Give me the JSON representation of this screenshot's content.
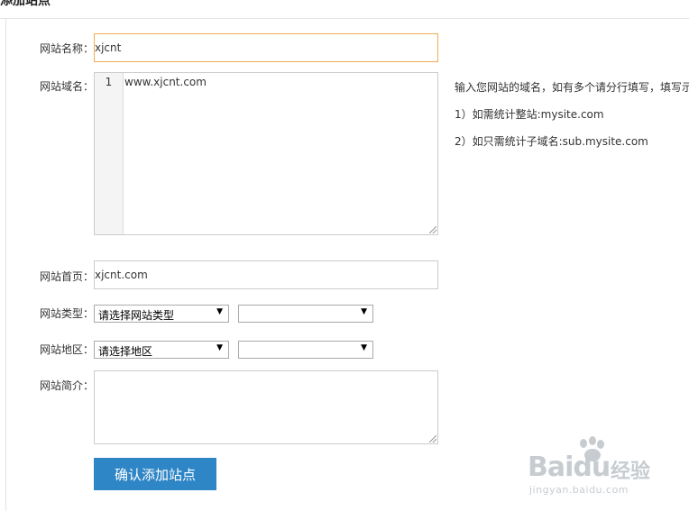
{
  "page": {
    "heading": "添加站点"
  },
  "form": {
    "site_name": {
      "label": "网站名称：",
      "value": "xjcnt"
    },
    "site_domain": {
      "label": "网站域名：",
      "line_number": "1",
      "value": "www.xjcnt.com",
      "help": [
        "输入您网站的域名，如有多个请分行填写，填写示",
        "1）如需统计整站:mysite.com",
        "2）如只需统计子域名:sub.mysite.com"
      ]
    },
    "site_home": {
      "label": "网站首页：",
      "value": "xjcnt.com"
    },
    "site_type": {
      "label": "网站类型：",
      "primary": "请选择网站类型",
      "secondary": ""
    },
    "site_region": {
      "label": "网站地区：",
      "primary": "请选择地区",
      "secondary": ""
    },
    "site_intro": {
      "label": "网站简介：",
      "value": ""
    },
    "submit_label": "确认添加站点"
  },
  "watermark": {
    "brand": "Bai",
    "brand2": "du",
    "product": "经验",
    "url": "jingyan.baidu.com"
  },
  "colors": {
    "accent": "#2f86c6",
    "focus_border": "#f0ad4e"
  }
}
